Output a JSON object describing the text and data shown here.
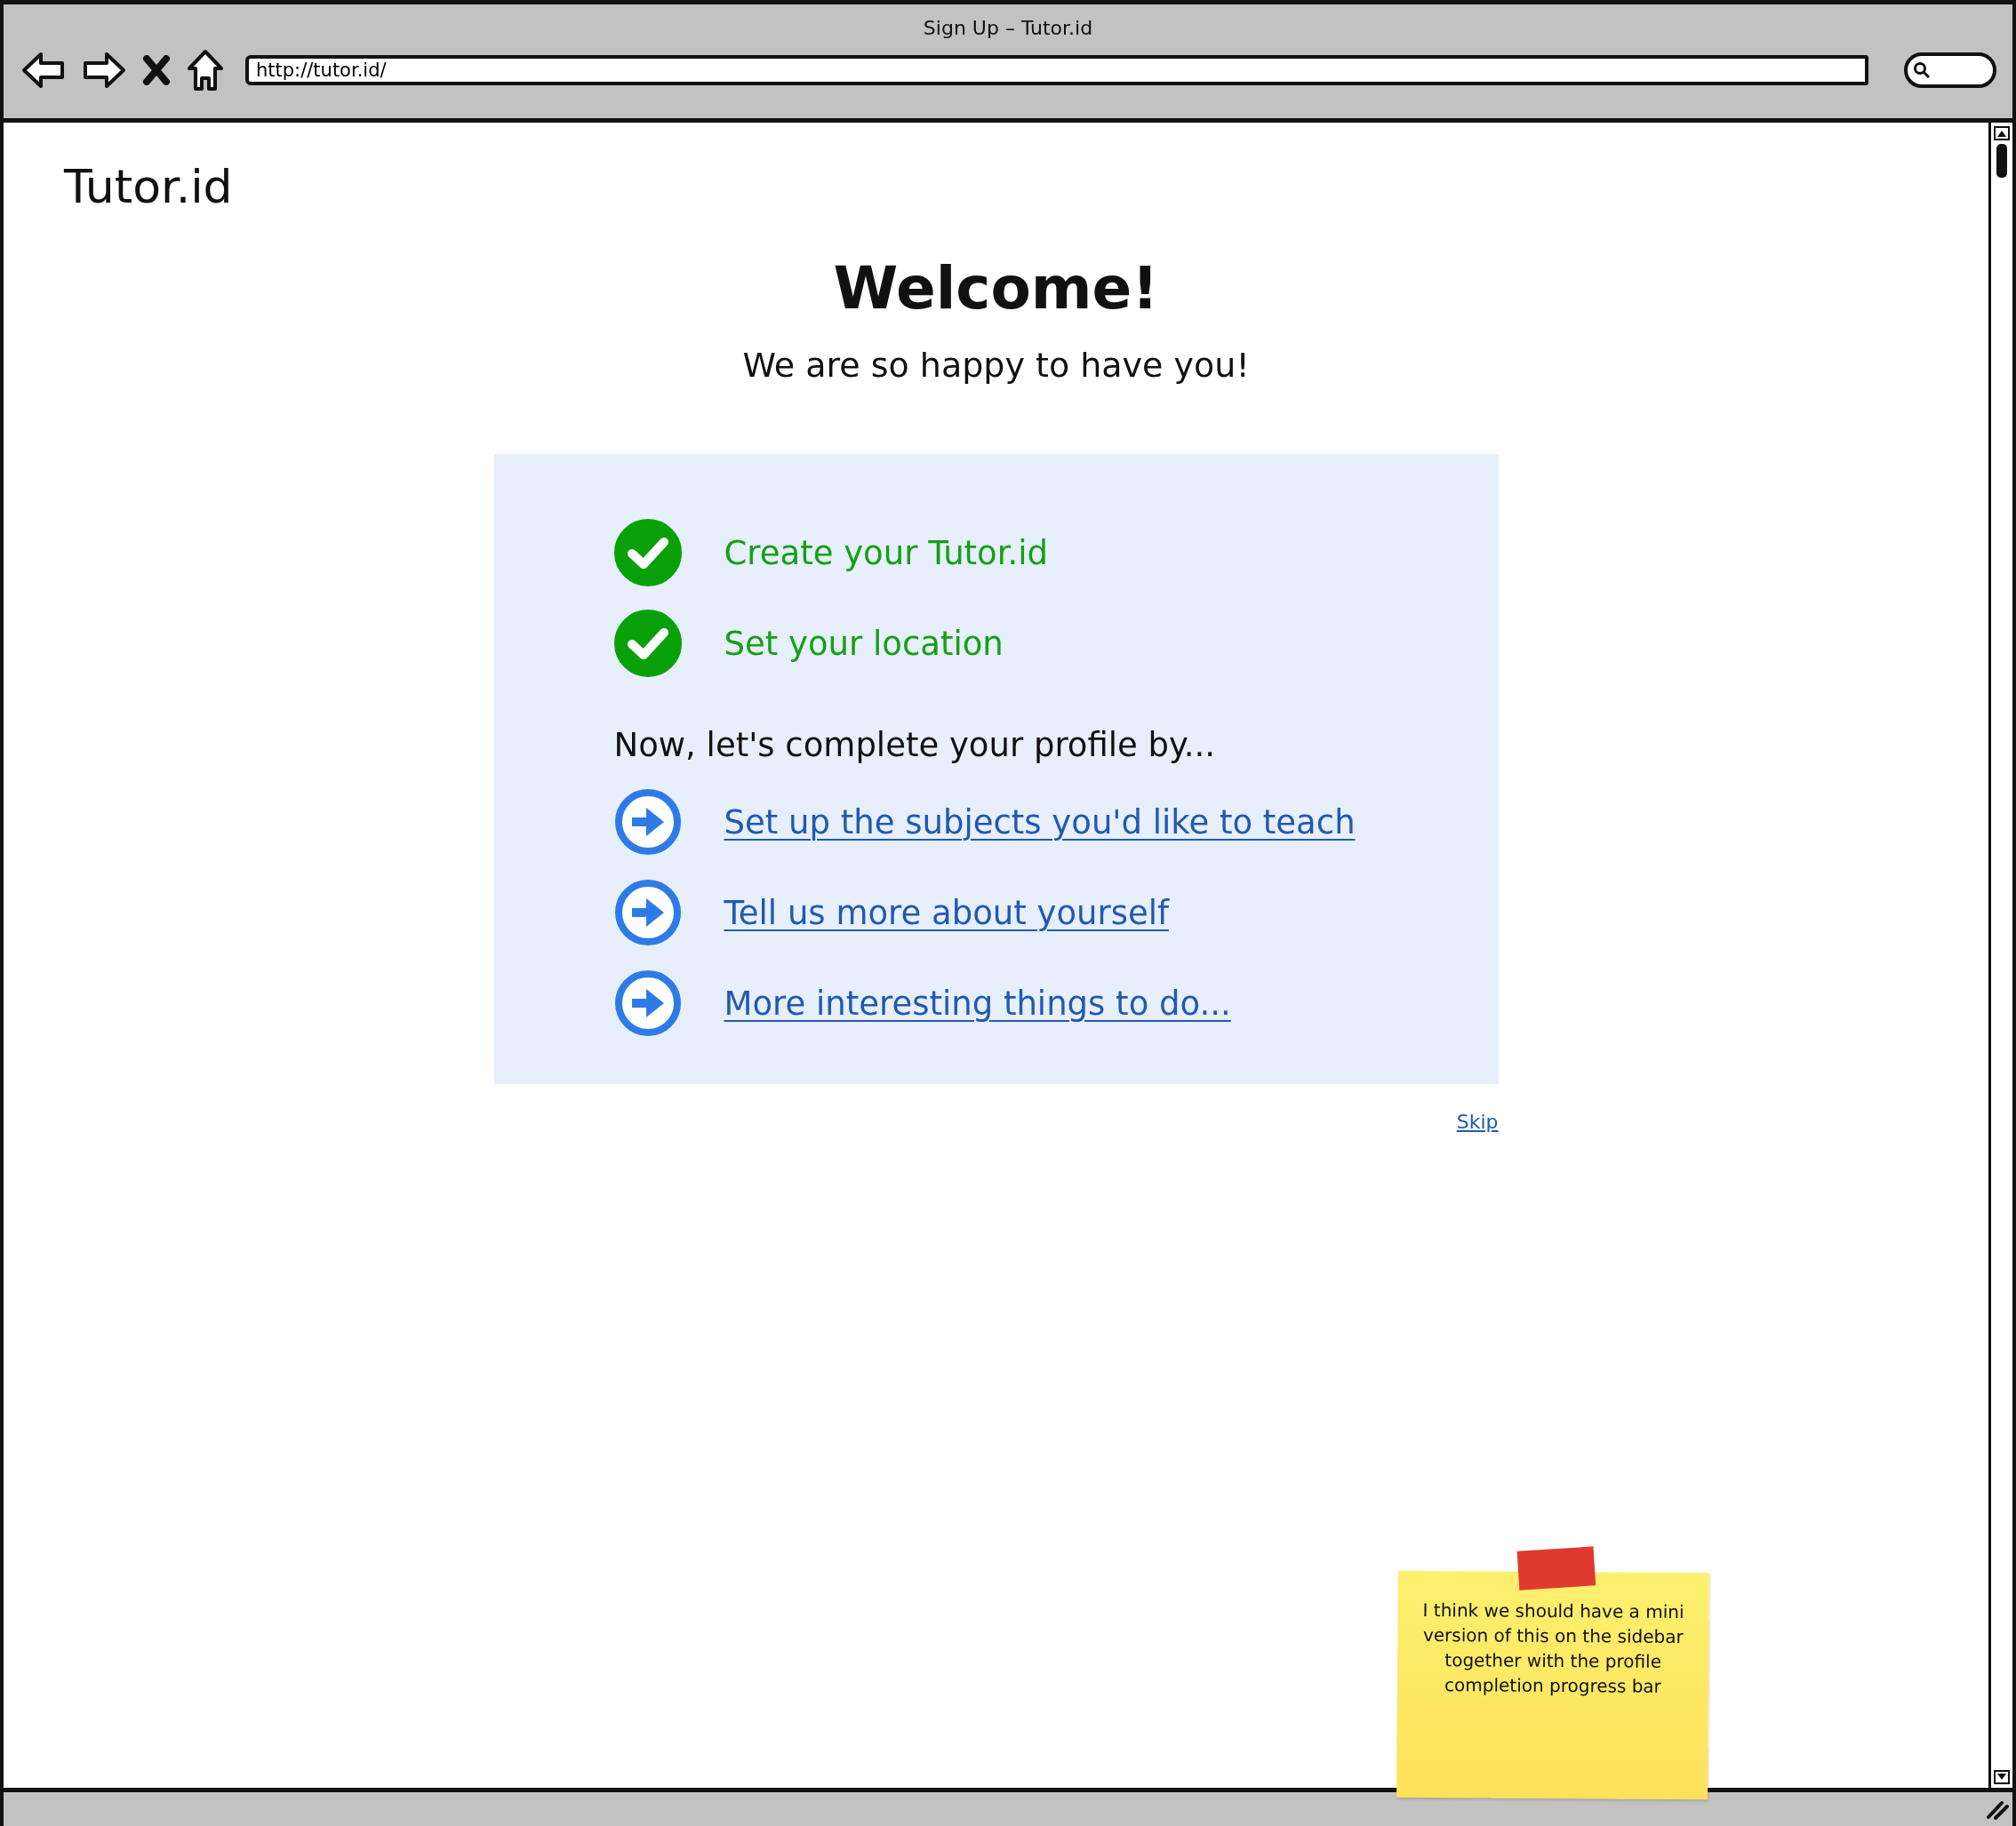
{
  "window": {
    "title": "Sign Up – Tutor.id"
  },
  "address_bar": {
    "value": "http://tutor.id/"
  },
  "logo": "Tutor.id",
  "heading": "Welcome!",
  "subheading": "We are so happy to have you!",
  "completed_steps": [
    {
      "label": "Create your Tutor.id",
      "checked": true
    },
    {
      "label": "Set your location",
      "checked": true
    }
  ],
  "intro": "Now, let's complete your profile by...",
  "next_steps": [
    {
      "label": "Set up the subjects you'd like to teach"
    },
    {
      "label": "Tell us more about yourself"
    },
    {
      "label": "More interesting things to do..."
    }
  ],
  "skip_link": "Skip",
  "sticky_note": {
    "text": "I think we should have a mini version of this on the sidebar together with the profile completion progress bar"
  }
}
